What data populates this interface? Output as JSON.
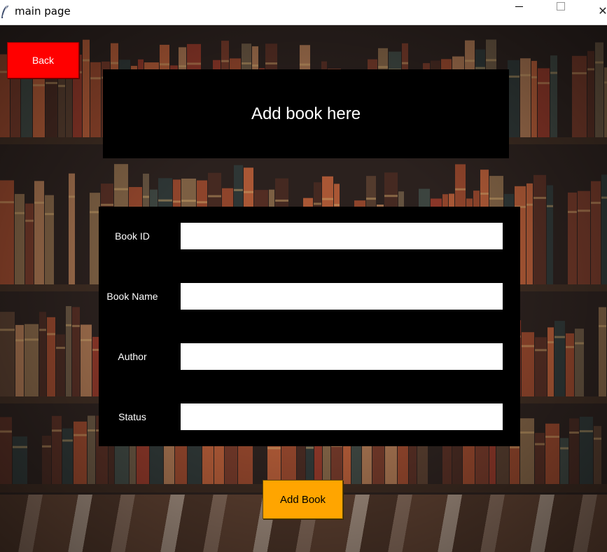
{
  "window": {
    "title": "main page",
    "icon": "feather-icon"
  },
  "back_button": {
    "label": "Back",
    "color": "#ff0000"
  },
  "header": {
    "title": "Add book here"
  },
  "form": {
    "fields": [
      {
        "label": "Book ID",
        "value": ""
      },
      {
        "label": "Book Name",
        "value": ""
      },
      {
        "label": "Author",
        "value": ""
      },
      {
        "label": "Status",
        "value": ""
      }
    ]
  },
  "add_button": {
    "label": "Add Book",
    "color": "#ffa500"
  }
}
